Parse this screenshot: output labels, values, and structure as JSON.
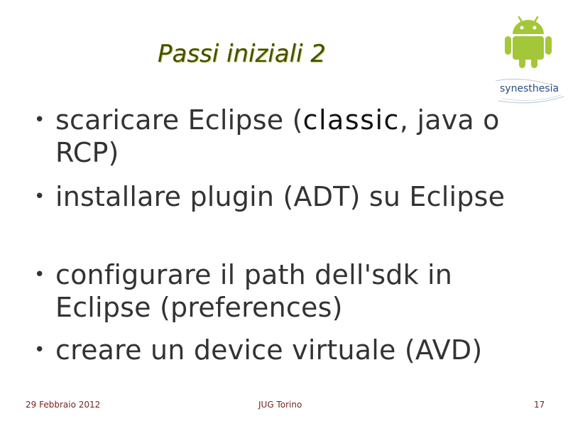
{
  "slide": {
    "title": "Passi iniziali 2",
    "logos": {
      "android": "android-robot-icon",
      "brand_name": "synesthesia"
    },
    "bullets": [
      {
        "before": "scaricare Eclipse (",
        "emphasis": "classic",
        "after": ", java o RCP)"
      },
      {
        "text": "installare plugin (ADT) su Eclipse"
      },
      {
        "text": "configurare il path dell'sdk in Eclipse (preferences)"
      },
      {
        "text": "creare un device virtuale (AVD)"
      }
    ],
    "bullet_glyph": "•",
    "footer": {
      "date": "29 Febbraio 2012",
      "event": "JUG Torino",
      "page_number": "17"
    },
    "colors": {
      "android_green": "#a4c639",
      "title_text": "#4c4c00",
      "title_shadow": "#b9d36a",
      "body_text": "#333333",
      "footer_text": "#7a1e1e",
      "brand_text": "#2a4d7a"
    }
  }
}
